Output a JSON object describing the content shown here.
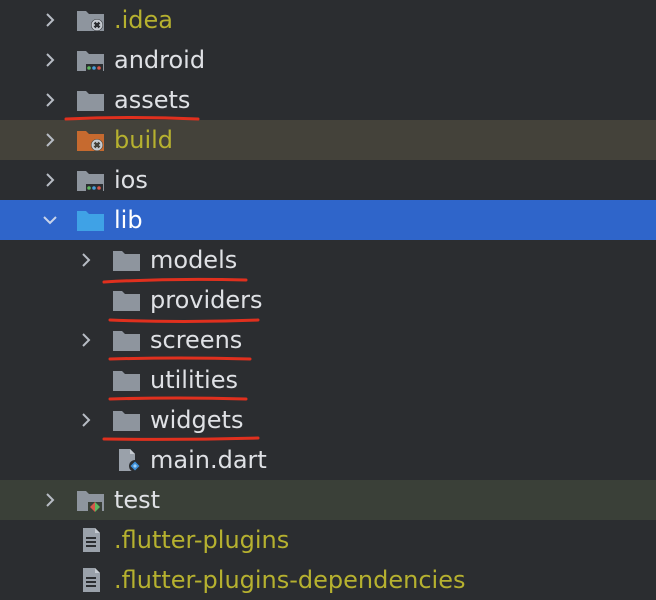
{
  "tree": {
    "items": [
      {
        "label": ".idea",
        "kind": "folder-gear",
        "color": "#b6b12f",
        "expandable": true
      },
      {
        "label": "android",
        "kind": "folder-android",
        "color": "#dfe1e5",
        "expandable": true
      },
      {
        "label": "assets",
        "kind": "folder",
        "color": "#dfe1e5",
        "expandable": true,
        "underlined": true
      },
      {
        "label": "build",
        "kind": "folder-build",
        "color": "#b6b12f",
        "expandable": true
      },
      {
        "label": "ios",
        "kind": "folder-ios",
        "color": "#dfe1e5",
        "expandable": true
      },
      {
        "label": "lib",
        "kind": "folder-source",
        "color": "#ffffff",
        "expandable": true,
        "expanded": true,
        "selected": true
      },
      {
        "label": "models",
        "kind": "folder",
        "color": "#dfe1e5",
        "expandable": true,
        "underlined": true
      },
      {
        "label": "providers",
        "kind": "folder",
        "color": "#dfe1e5",
        "expandable": false,
        "underlined": true
      },
      {
        "label": "screens",
        "kind": "folder",
        "color": "#dfe1e5",
        "expandable": true,
        "underlined": true
      },
      {
        "label": "utilities",
        "kind": "folder",
        "color": "#dfe1e5",
        "expandable": false,
        "underlined": true
      },
      {
        "label": "widgets",
        "kind": "folder",
        "color": "#dfe1e5",
        "expandable": true,
        "underlined": true
      },
      {
        "label": "main.dart",
        "kind": "dart-file",
        "color": "#dfe1e5",
        "expandable": false
      },
      {
        "label": "test",
        "kind": "folder-test",
        "color": "#dfe1e5",
        "expandable": true
      },
      {
        "label": ".flutter-plugins",
        "kind": "text-file",
        "color": "#b6b12f",
        "expandable": false
      },
      {
        "label": ".flutter-plugins-dependencies",
        "kind": "text-file",
        "color": "#b6b12f",
        "expandable": false
      }
    ]
  },
  "colors": {
    "background": "#2b2d30",
    "selected_row": "#2f65ca",
    "build_row": "#44423a",
    "test_row": "#3a4038",
    "folder_icon": "#8e959e",
    "annotation_underline": "#e0301e"
  }
}
